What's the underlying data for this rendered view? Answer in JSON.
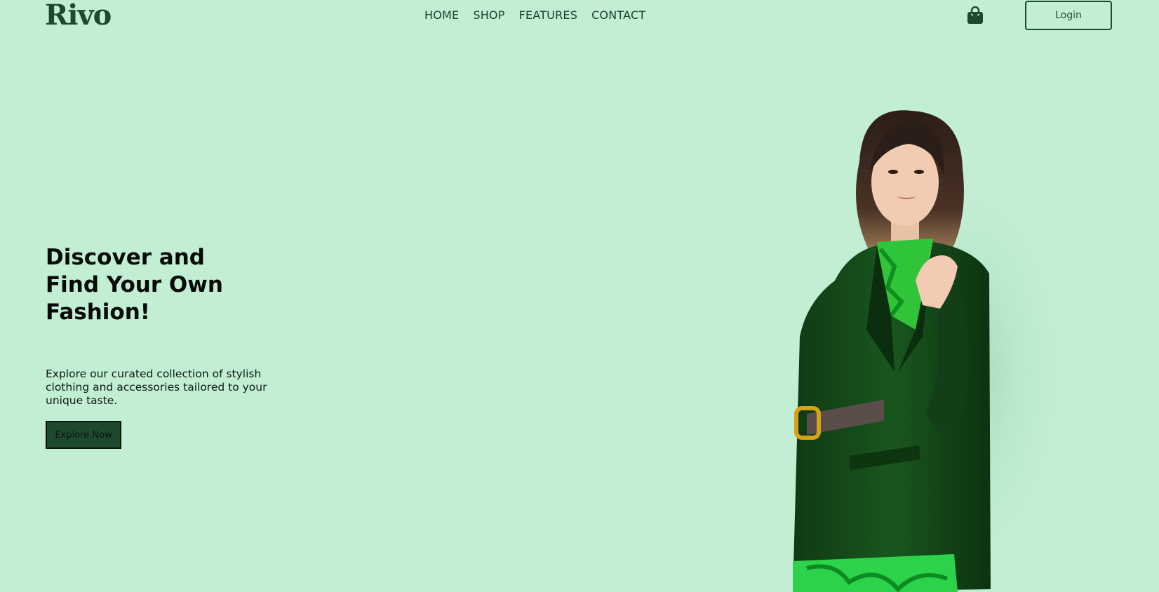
{
  "brand": {
    "name": "Rivo"
  },
  "nav": {
    "items": [
      {
        "label": "HOME"
      },
      {
        "label": "SHOP"
      },
      {
        "label": "FEATURES"
      },
      {
        "label": "CONTACT"
      }
    ]
  },
  "header": {
    "cart_icon": "shopping-bag-icon",
    "login_label": "Login"
  },
  "hero": {
    "title_lines": [
      "Discover and",
      "Find Your Own",
      "Fashion!"
    ],
    "description": "Explore our curated collection of stylish clothing and accessories tailored to your unique taste.",
    "cta_label": "Explore Now"
  },
  "colors": {
    "background": "#c2eed3",
    "brand_green": "#1d4a2f",
    "text_dark": "#050a07"
  }
}
